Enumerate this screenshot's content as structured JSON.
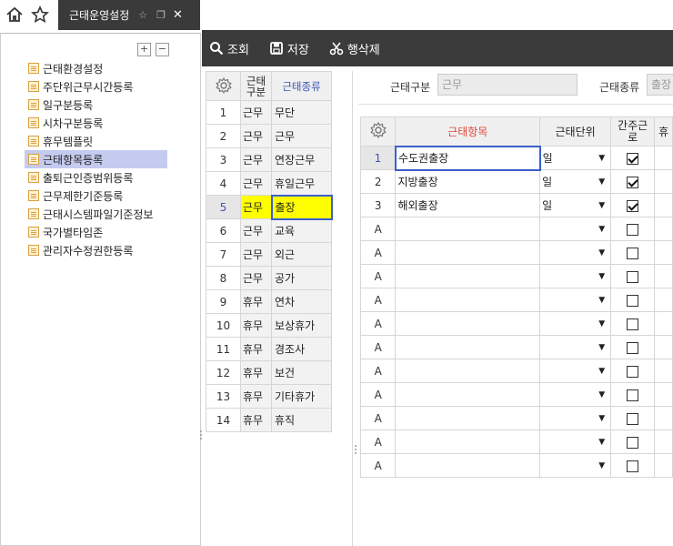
{
  "topbar": {
    "tab_title": "근태운영설정"
  },
  "sidebar": {
    "items": [
      {
        "label": "근태환경설정"
      },
      {
        "label": "주단위근무시간등록"
      },
      {
        "label": "일구분등록"
      },
      {
        "label": "시차구분등록"
      },
      {
        "label": "휴무템플릿"
      },
      {
        "label": "근태항목등록"
      },
      {
        "label": "출퇴근인증범위등록"
      },
      {
        "label": "근무제한기준등록"
      },
      {
        "label": "근태시스템파일기준정보"
      },
      {
        "label": "국가별타임존"
      },
      {
        "label": "관리자수정권한등록"
      }
    ],
    "selected_index": 5
  },
  "toolbar": {
    "search_label": "조회",
    "save_label": "저장",
    "delete_row_label": "행삭제"
  },
  "left_grid": {
    "headers": {
      "type": "근태\n구분",
      "kind": "근태종류"
    },
    "rows": [
      {
        "no": "1",
        "type": "근무",
        "kind": "무단"
      },
      {
        "no": "2",
        "type": "근무",
        "kind": "근무"
      },
      {
        "no": "3",
        "type": "근무",
        "kind": "연장근무"
      },
      {
        "no": "4",
        "type": "근무",
        "kind": "휴일근무"
      },
      {
        "no": "5",
        "type": "근무",
        "kind": "출장"
      },
      {
        "no": "6",
        "type": "근무",
        "kind": "교육"
      },
      {
        "no": "7",
        "type": "근무",
        "kind": "외근"
      },
      {
        "no": "8",
        "type": "근무",
        "kind": "공가"
      },
      {
        "no": "9",
        "type": "휴무",
        "kind": "연차"
      },
      {
        "no": "10",
        "type": "휴무",
        "kind": "보상휴가"
      },
      {
        "no": "11",
        "type": "휴무",
        "kind": "경조사"
      },
      {
        "no": "12",
        "type": "휴무",
        "kind": "보건"
      },
      {
        "no": "13",
        "type": "휴무",
        "kind": "기타휴가"
      },
      {
        "no": "14",
        "type": "휴무",
        "kind": "휴직"
      }
    ],
    "selected_index": 4
  },
  "filter": {
    "type_label": "근태구분",
    "type_value": "근무",
    "kind_label": "근태종류",
    "kind_value": "출장"
  },
  "right_grid": {
    "headers": {
      "item": "근태항목",
      "unit": "근태단위",
      "deemed": "간주근\n로",
      "extra": "휴"
    },
    "rows": [
      {
        "no": "1",
        "item": "수도권출장",
        "unit": "일",
        "checked": true
      },
      {
        "no": "2",
        "item": "지방출장",
        "unit": "일",
        "checked": true
      },
      {
        "no": "3",
        "item": "해외출장",
        "unit": "일",
        "checked": true
      },
      {
        "no": "A",
        "item": "",
        "unit": "",
        "checked": false
      },
      {
        "no": "A",
        "item": "",
        "unit": "",
        "checked": false
      },
      {
        "no": "A",
        "item": "",
        "unit": "",
        "checked": false
      },
      {
        "no": "A",
        "item": "",
        "unit": "",
        "checked": false
      },
      {
        "no": "A",
        "item": "",
        "unit": "",
        "checked": false
      },
      {
        "no": "A",
        "item": "",
        "unit": "",
        "checked": false
      },
      {
        "no": "A",
        "item": "",
        "unit": "",
        "checked": false
      },
      {
        "no": "A",
        "item": "",
        "unit": "",
        "checked": false
      },
      {
        "no": "A",
        "item": "",
        "unit": "",
        "checked": false
      },
      {
        "no": "A",
        "item": "",
        "unit": "",
        "checked": false
      },
      {
        "no": "A",
        "item": "",
        "unit": "",
        "checked": false
      }
    ],
    "selected_index": 0
  },
  "colors": {
    "toolbar_bg": "#3b3b3b",
    "highlight_yellow": "#ffff00",
    "selection_blue": "#3a5fcd",
    "tree_selected": "#c5cbef",
    "header_red": "#e0463c",
    "header_blue": "#3b53b5"
  }
}
